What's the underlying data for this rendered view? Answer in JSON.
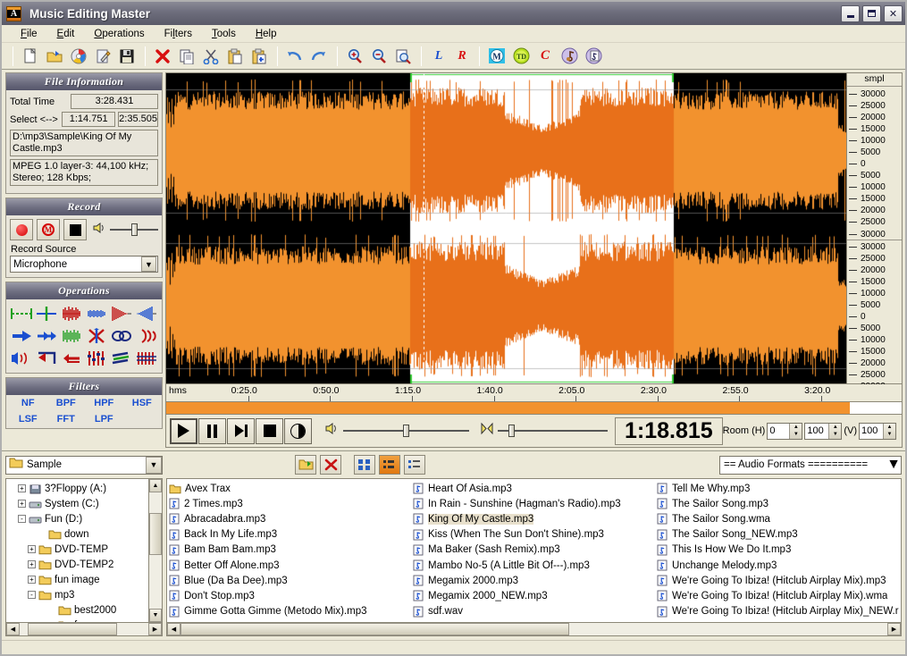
{
  "window": {
    "title": "Music Editing Master",
    "icon": "app-icon",
    "minimize": "_",
    "maximize": "□",
    "close": "✕"
  },
  "menu": [
    "File",
    "Edit",
    "Operations",
    "Filters",
    "Tools",
    "Help"
  ],
  "toolbar": {
    "groups": [
      [
        "new-file-icon",
        "open-folder-icon",
        "cd-audio-icon",
        "edit-note-icon",
        "save-disk-icon"
      ],
      [
        "delete-x-icon",
        "copy-icon",
        "cut-scissors-icon",
        "paste-icon",
        "paste-new-icon"
      ],
      [
        "undo-icon",
        "redo-icon"
      ],
      [
        "zoom-in-icon",
        "zoom-out-icon",
        "zoom-selection-icon"
      ],
      [
        "channel-left",
        "channel-right"
      ],
      [
        "mixer-m-icon",
        "td-icon",
        "c-icon",
        "music-note-icon",
        "music-page-icon"
      ]
    ],
    "left_channel": "L",
    "right_channel": "R",
    "c_label": "C"
  },
  "file_information": {
    "header": "File Information",
    "total_time_label": "Total Time",
    "total_time_value": "3:28.431",
    "select_label": "Select <-->",
    "select_start": "1:14.751",
    "select_end": "2:35.505",
    "path": "D:\\mp3\\Sample\\King Of My Castle.mp3",
    "format": "MPEG 1.0 layer-3: 44,100 kHz; Stereo; 128 Kbps;"
  },
  "record": {
    "header": "Record",
    "buttons": [
      "record-dot-button",
      "record-mono-button",
      "record-stop-button"
    ],
    "volume_icon": "speaker-icon",
    "source_label": "Record Source",
    "source_value": "Microphone"
  },
  "operations": {
    "header": "Operations",
    "icons": [
      "trim-icon",
      "insert-silence-icon",
      "amplify-icon",
      "normalize-icon",
      "fade-out-icon",
      "fade-in-icon",
      "forward-icon",
      "swap-channels-icon",
      "noise-gate-icon",
      "cross-fade-icon",
      "echo-icon",
      "chorus-icon",
      "vibrato-icon",
      "reverse-icon",
      "flip-icon",
      "equalizer-icon",
      "flanger-icon",
      "pitch-icon"
    ]
  },
  "filters": {
    "header": "Filters",
    "items": [
      "NF",
      "BPF",
      "HPF",
      "HSF",
      "LSF",
      "FFT",
      "LPF"
    ]
  },
  "waveform": {
    "scale_header": "smpl",
    "scale_labels": [
      "30000",
      "25000",
      "20000",
      "15000",
      "10000",
      "5000",
      "0",
      "5000",
      "10000",
      "15000",
      "20000",
      "25000",
      "30000"
    ],
    "ruler_unit": "hms",
    "ruler_ticks": [
      "0:25.0",
      "0:50.0",
      "1:15.0",
      "1:40.0",
      "2:05.0",
      "2:30.0",
      "2:55.0",
      "3:20.0"
    ],
    "wave_color": "#f2922e",
    "wave_color_selected": "#e8701a",
    "background_color": "#000000",
    "background_color_selected": "#ffffff",
    "selection_marker_color": "#33cc33",
    "total_seconds": 208.431,
    "selection_start_seconds": 74.751,
    "selection_end_seconds": 155.505,
    "playhead_seconds": 78.815,
    "position_progress_percent": 93
  },
  "transport": {
    "buttons": [
      "play-button",
      "pause-button",
      "step-button",
      "stop-button",
      "loop-button"
    ],
    "volume_icon": "speaker-icon",
    "balance_icon": "balance-icon",
    "time_display": "1:18.815",
    "room_label": "Room (H)",
    "room_h1": "0",
    "room_h2": "100",
    "room_v_label": "(V)",
    "room_v": "100"
  },
  "browser": {
    "folder_value": "Sample",
    "folder_icon": "folder-icon",
    "buttons": [
      "new-folder-button",
      "delete-button",
      "thumbnails-view-button",
      "icons-view-button",
      "list-view-button"
    ],
    "format_value": "== Audio Formats ==========",
    "tree": [
      {
        "label": "3?Floppy (A:)",
        "indent": 1,
        "expander": "+",
        "icon": "floppy-icon"
      },
      {
        "label": "System (C:)",
        "indent": 1,
        "expander": "+",
        "icon": "drive-icon"
      },
      {
        "label": "Fun (D:)",
        "indent": 1,
        "expander": "-",
        "icon": "drive-icon"
      },
      {
        "label": "down",
        "indent": 3,
        "expander": "",
        "icon": "folder-icon"
      },
      {
        "label": "DVD-TEMP",
        "indent": 2,
        "expander": "+",
        "icon": "folder-icon"
      },
      {
        "label": "DVD-TEMP2",
        "indent": 2,
        "expander": "+",
        "icon": "folder-icon"
      },
      {
        "label": "fun image",
        "indent": 2,
        "expander": "+",
        "icon": "folder-icon"
      },
      {
        "label": "mp3",
        "indent": 2,
        "expander": "-",
        "icon": "folder-icon"
      },
      {
        "label": "best2000",
        "indent": 4,
        "expander": "",
        "icon": "folder-icon"
      },
      {
        "label": "fun",
        "indent": 4,
        "expander": "",
        "icon": "folder-icon"
      }
    ],
    "files_col1": [
      {
        "name": "Avex Trax",
        "icon": "folder-icon",
        "selected": false
      },
      {
        "name": "2 Times.mp3",
        "icon": "audio-icon",
        "selected": false
      },
      {
        "name": "Abracadabra.mp3",
        "icon": "audio-icon",
        "selected": false
      },
      {
        "name": "Back In My Life.mp3",
        "icon": "audio-icon",
        "selected": false
      },
      {
        "name": "Bam Bam Bam.mp3",
        "icon": "audio-icon",
        "selected": false
      },
      {
        "name": "Better Off Alone.mp3",
        "icon": "audio-icon",
        "selected": false
      },
      {
        "name": "Blue (Da Ba Dee).mp3",
        "icon": "audio-icon",
        "selected": false
      },
      {
        "name": "Don't Stop.mp3",
        "icon": "audio-icon",
        "selected": false
      },
      {
        "name": "Gimme Gotta Gimme (Metodo Mix).mp3",
        "icon": "audio-icon",
        "selected": false
      }
    ],
    "files_col2": [
      {
        "name": "Heart Of Asia.mp3",
        "icon": "audio-icon",
        "selected": false
      },
      {
        "name": "In Rain - Sunshine (Hagman's Radio).mp3",
        "icon": "audio-icon",
        "selected": false
      },
      {
        "name": "King Of My Castle.mp3",
        "icon": "audio-icon",
        "selected": true
      },
      {
        "name": "Kiss (When The Sun Don't Shine).mp3",
        "icon": "audio-icon",
        "selected": false
      },
      {
        "name": "Ma Baker (Sash Remix).mp3",
        "icon": "audio-icon",
        "selected": false
      },
      {
        "name": "Mambo No-5 (A Little Bit Of---).mp3",
        "icon": "audio-icon",
        "selected": false
      },
      {
        "name": "Megamix 2000.mp3",
        "icon": "audio-icon",
        "selected": false
      },
      {
        "name": "Megamix 2000_NEW.mp3",
        "icon": "audio-icon",
        "selected": false
      },
      {
        "name": "sdf.wav",
        "icon": "audio-icon",
        "selected": false
      }
    ],
    "files_col3": [
      {
        "name": "Tell Me Why.mp3",
        "icon": "audio-icon",
        "selected": false
      },
      {
        "name": "The Sailor Song.mp3",
        "icon": "audio-icon",
        "selected": false
      },
      {
        "name": "The Sailor Song.wma",
        "icon": "audio-icon",
        "selected": false
      },
      {
        "name": "The Sailor Song_NEW.mp3",
        "icon": "audio-icon",
        "selected": false
      },
      {
        "name": "This Is How We Do It.mp3",
        "icon": "audio-icon",
        "selected": false
      },
      {
        "name": "Unchange Melody.mp3",
        "icon": "audio-icon",
        "selected": false
      },
      {
        "name": "We're Going To Ibiza! (Hitclub Airplay Mix).mp3",
        "icon": "audio-icon",
        "selected": false
      },
      {
        "name": "We're Going To Ibiza! (Hitclub Airplay Mix).wma",
        "icon": "audio-icon",
        "selected": false
      },
      {
        "name": "We're Going To Ibiza! (Hitclub Airplay Mix)_NEW.r",
        "icon": "audio-icon",
        "selected": false
      }
    ]
  }
}
